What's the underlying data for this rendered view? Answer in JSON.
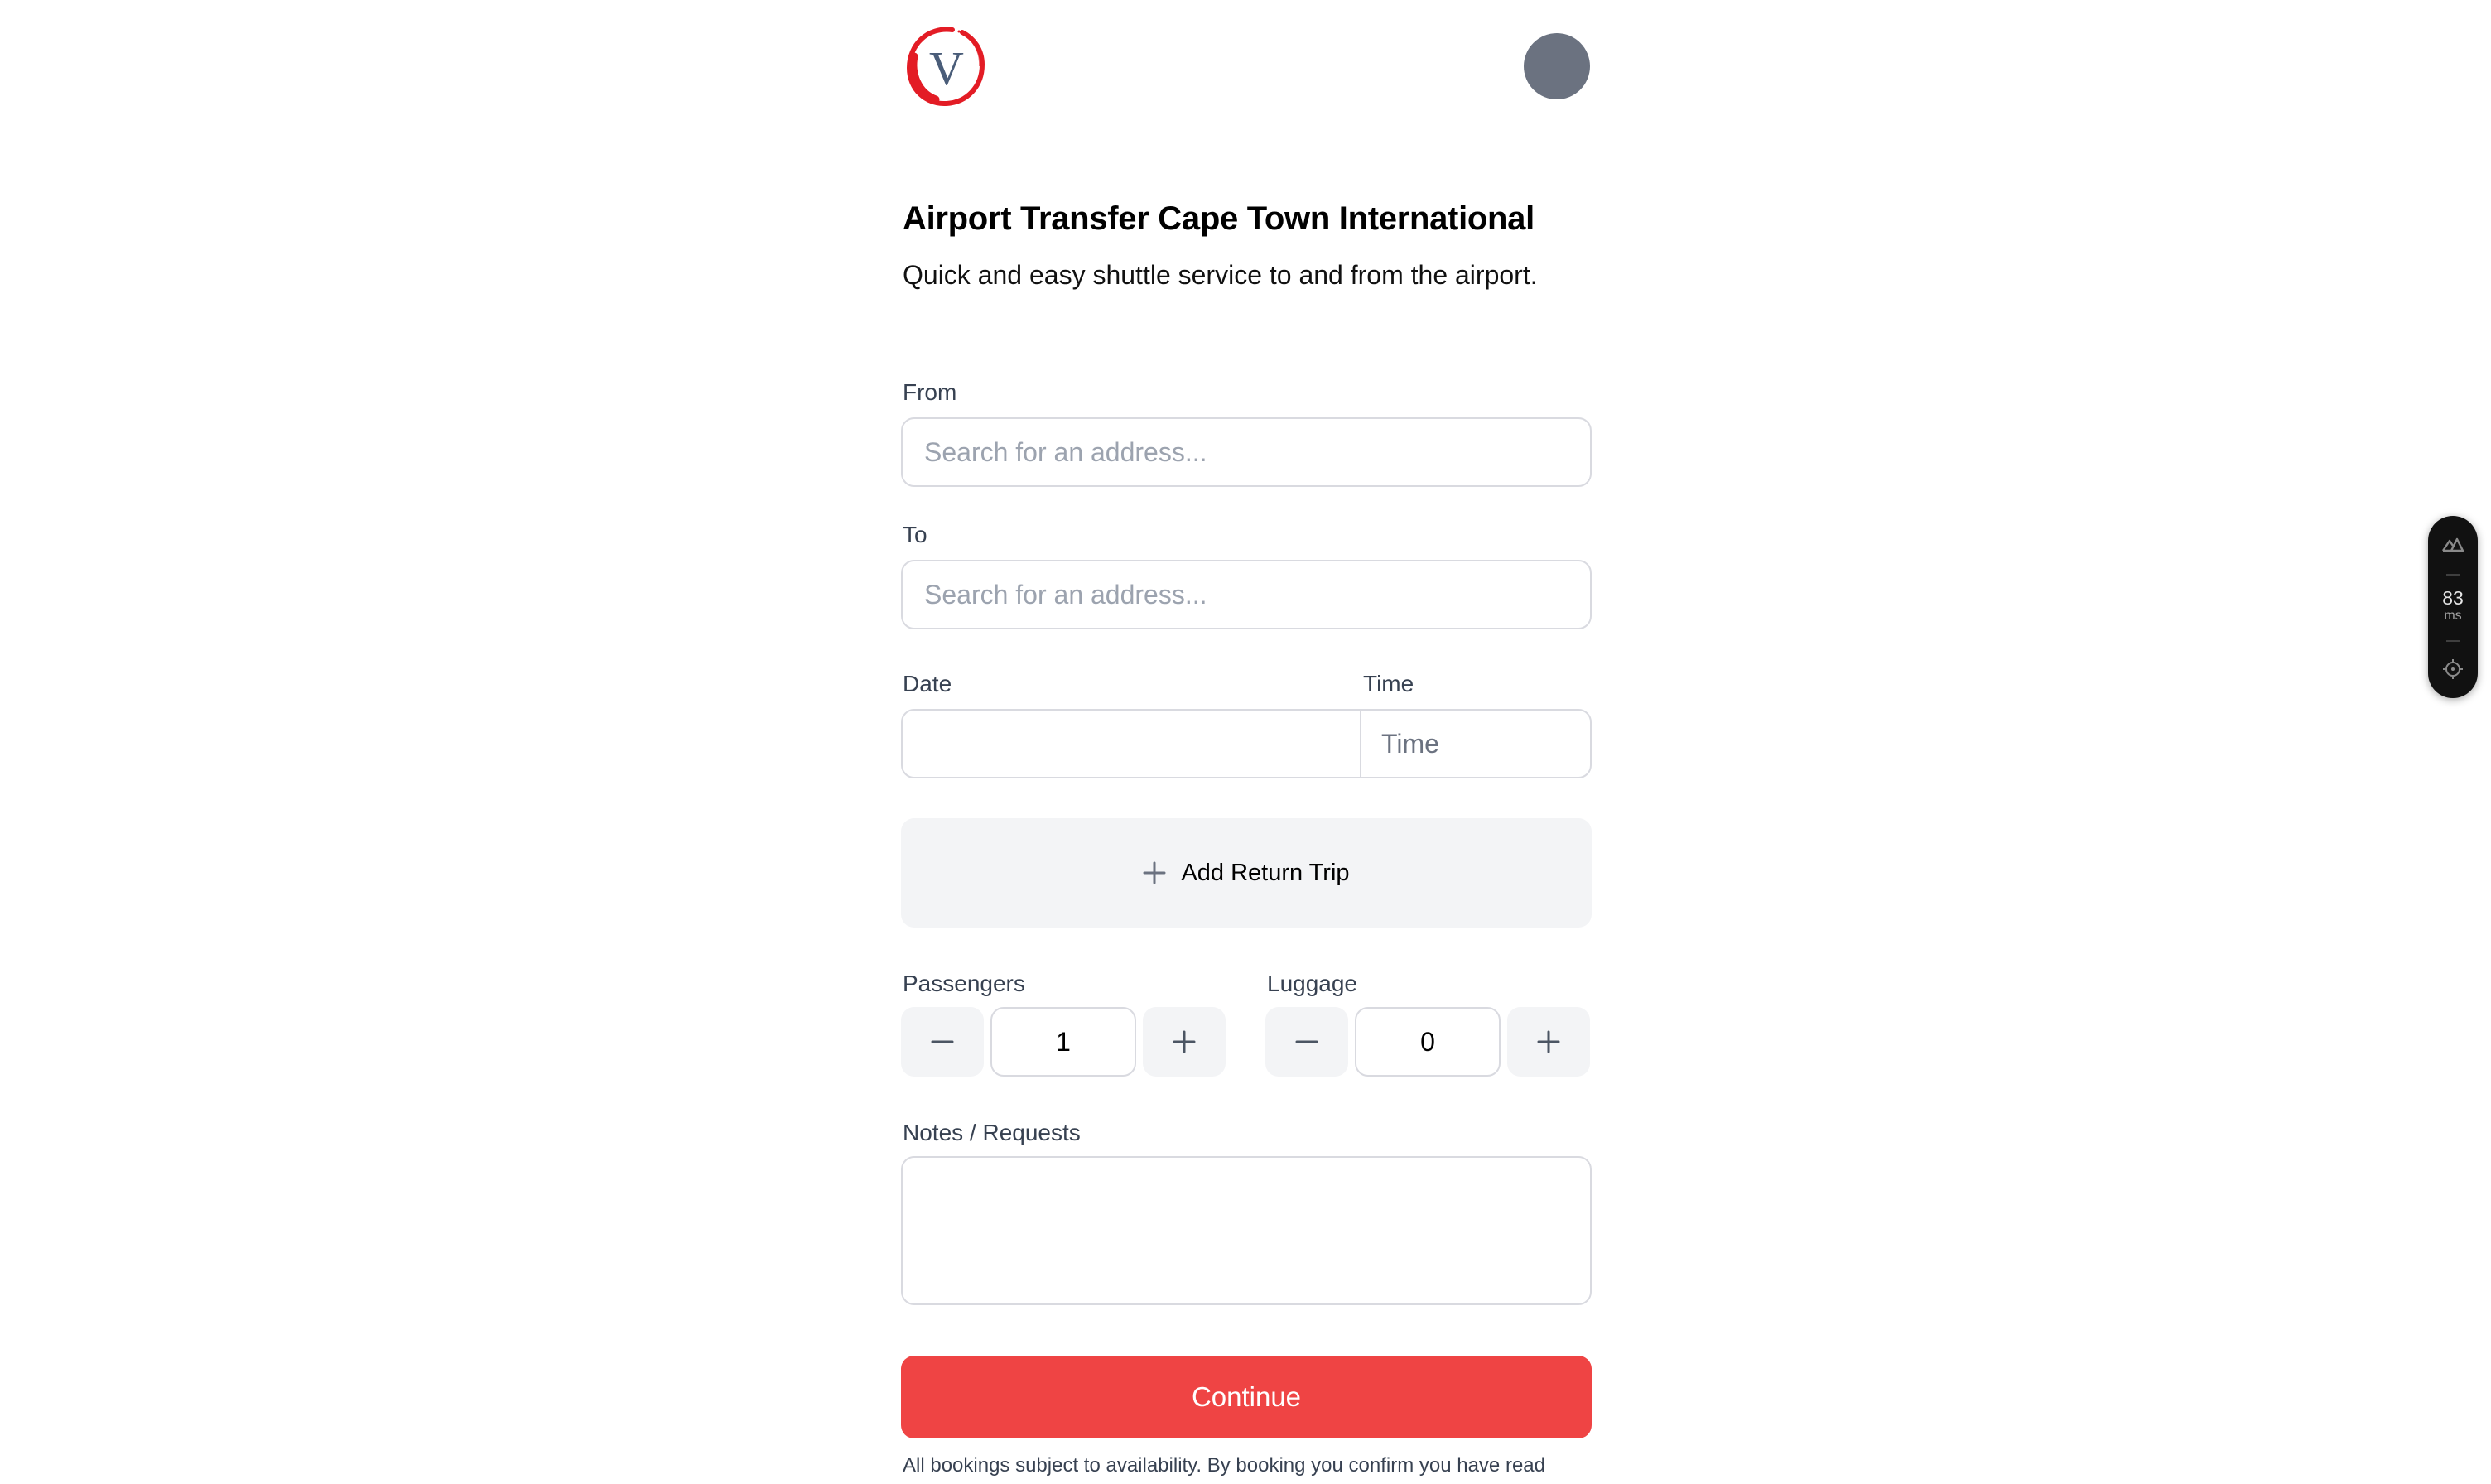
{
  "header": {
    "logo_letter": "V",
    "logo_icon": "brand-logo-icon",
    "avatar_icon": "user-avatar"
  },
  "page": {
    "title": "Airport Transfer Cape Town International",
    "subtitle": "Quick and easy shuttle service to and from the airport."
  },
  "form": {
    "from": {
      "label": "From",
      "placeholder": "Search for an address...",
      "value": ""
    },
    "to": {
      "label": "To",
      "placeholder": "Search for an address...",
      "value": ""
    },
    "date": {
      "label": "Date",
      "value": ""
    },
    "time": {
      "label": "Time",
      "placeholder": "Time",
      "value": ""
    },
    "return_trip": {
      "label": "Add Return Trip",
      "icon": "plus-icon"
    },
    "passengers": {
      "label": "Passengers",
      "value": "1",
      "decrement_icon": "minus-icon",
      "increment_icon": "plus-icon"
    },
    "luggage": {
      "label": "Luggage",
      "value": "0",
      "decrement_icon": "minus-icon",
      "increment_icon": "plus-icon"
    },
    "notes": {
      "label": "Notes / Requests",
      "value": ""
    },
    "submit_label": "Continue",
    "footer_text": "All bookings subject to availability. By booking you confirm you have read"
  },
  "dev_widget": {
    "top_icon": "nuxt-logo-icon",
    "render_time": "83",
    "render_unit": "ms",
    "bottom_icon": "inspect-target-icon"
  },
  "colors": {
    "primary": "#ef4444",
    "logo_red": "#e31c25",
    "logo_letter": "#4a5d79",
    "avatar": "#6b7280",
    "button_bg": "#f3f4f6",
    "label_text": "#374151",
    "border": "#d9dae0"
  }
}
